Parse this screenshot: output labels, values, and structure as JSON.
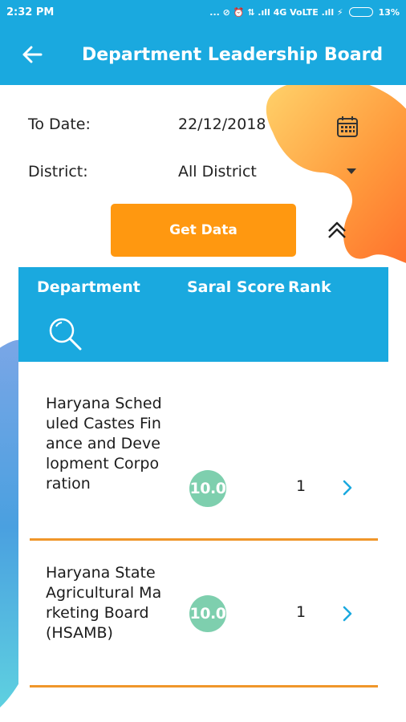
{
  "status_bar": {
    "time": "2:32 PM",
    "indicators": "... ⊘ ⏰ ⇅ .ıll 4G VoLTE .ıll ⚡",
    "battery": "13%"
  },
  "app_bar": {
    "title": "Department Leadership Board",
    "back_icon": "arrow-left-icon"
  },
  "form": {
    "to_date_label": "To Date:",
    "to_date_value": "22/12/2018",
    "district_label": "District:",
    "district_value": "All District",
    "get_data_label": "Get Data"
  },
  "table": {
    "headers": {
      "department": "Department",
      "saral_score": "Saral Score",
      "rank": "Rank"
    },
    "rows": [
      {
        "department": "Haryana Scheduled Castes Finance and Development Corporation",
        "score": "10.0",
        "rank": "1"
      },
      {
        "department": "Haryana State Agricultural Marketing Board(HSAMB)",
        "score": "10.0",
        "rank": "1"
      }
    ]
  },
  "colors": {
    "primary_blue": "#1aa9df",
    "accent_orange": "#ff9810",
    "score_green": "#7ecfae",
    "divider_orange": "#f0962a"
  }
}
